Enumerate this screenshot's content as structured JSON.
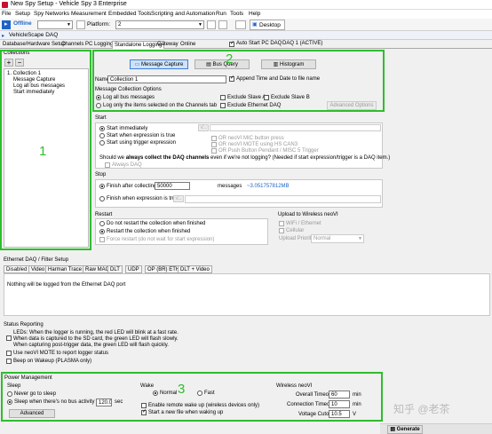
{
  "window": {
    "title": "New Spy Setup - Vehicle Spy 3 Enterprise"
  },
  "menu": [
    "File",
    "Setup",
    "Spy Networks",
    "Measurement",
    "Embedded Tools",
    "Scripting and Automation",
    "Run",
    "Tools",
    "Help"
  ],
  "toolbar": {
    "online_label": "Offline",
    "platform_label": "Platform:",
    "platform_value": "2",
    "desktop_tab": "Desktop 1"
  },
  "vehiclescape": {
    "title": "VehicleScape DAQ"
  },
  "tabs": [
    "Database/Hardware Setup",
    "Channels",
    "PC Logging",
    "Standalone Logging",
    "Gateway",
    "Online"
  ],
  "auto_start": {
    "label": "Auto Start PC DAQ",
    "daq_label": "DAQ 1 (ACTIVE)"
  },
  "collections": {
    "title": "Collections",
    "add": "+",
    "remove": "−",
    "root": "1. Collection 1",
    "children": [
      "Message Capture",
      "Log all bus messages",
      "Start immediately"
    ]
  },
  "capture_buttons": {
    "message_capture": "Message Capture",
    "bus_query": "Bus Query",
    "histogram": "Histogram"
  },
  "name_row": {
    "label": "Name",
    "value": "Collection 1",
    "append_label": "Append Time and Date to file name"
  },
  "msg_options": {
    "title": "Message Collection Options",
    "log_all": "Log all bus messages",
    "log_only": "Log only the items selected on the Channels tab",
    "exclude_a": "Exclude Slave A",
    "exclude_b": "Exclude Slave B",
    "exclude_eth": "Exclude Ethernet DAQ",
    "advanced": "Advanced Options"
  },
  "start": {
    "title": "Start",
    "immediately": "Start immediately",
    "when_expr": "Start when expression is true",
    "trigger_expr": "Start using trigger expression",
    "mic_button": "OR neoVI MIC button press",
    "mote_hs": "OR neoVI MOTE using HS CAN3",
    "push_button": "OR Push Button Pendant / MISC 5 Trigger",
    "should_prefix": "Should we ",
    "should_bold": "always collect the DAQ channels",
    "should_suffix": " even if we're not logging? (Needed if start expression/trigger is a DAQ item.)",
    "always_daq": "Always DAQ",
    "expr_btn": "√.."
  },
  "stop": {
    "title": "Stop",
    "finish_after": "Finish after collecting",
    "count": "50000",
    "messages": "messages",
    "size": "~3.051757812MB",
    "finish_when": "Finish when expression is true",
    "expr_btn": "√.."
  },
  "restart": {
    "title": "Restart",
    "do_not": "Do not restart the collection when finished",
    "restart": "Restart the collection when finished",
    "force": "Force restart (do not wait for start expression)"
  },
  "upload": {
    "title": "Upload to Wireless neoVI",
    "wifi": "WiFi / Ethernet",
    "cellular": "Cellular",
    "priority_label": "Upload Priority",
    "priority_value": "Normal"
  },
  "eth_daq": {
    "title": "Ethernet DAQ / Filter Setup",
    "tabs": [
      "Disabled",
      "Video",
      "Harman Trace",
      "Raw MAC",
      "DLT",
      "UDP",
      "OP (BR) ETH",
      "DLT + Video"
    ],
    "message": "Nothing will be logged from the Ethernet DAQ port"
  },
  "status": {
    "title": "Status Reporting",
    "leds_lines": [
      "LEDs: When the logger is running, the red LED will blink at a fast rate.",
      "When data is captured to the SD card, the green LED will flash slowly.",
      "When capturing post-trigger data, the green LED will flash quickly."
    ],
    "use_mote": "Use neoVI MOTE to report logger status",
    "beep": "Beep on Wakeup (PLASMA only)"
  },
  "power": {
    "title": "Power Management",
    "sleep_title": "Sleep",
    "never": "Never go to sleep",
    "sleep_when": "Sleep when there's no bus activity for",
    "sleep_value": "120.00",
    "sec": "sec",
    "advanced": "Advanced",
    "wake_title": "Wake",
    "normal": "Normal",
    "fast": "Fast",
    "remote_wakeup": "Enable remote wake up (wireless devices only)",
    "new_file": "Start a new file when waking up",
    "wireless_title": "Wireless neoVI",
    "overall_label": "Overall Timeout:",
    "overall_value": "60",
    "conn_label": "Connection Timeout:",
    "conn_value": "10",
    "voltage_label": "Voltage Cutoff:",
    "voltage_value": "10.5",
    "min": "min",
    "volt": "V"
  },
  "annotations": {
    "one": "1",
    "two": "2",
    "three": "3"
  },
  "watermark": "知乎 @老茶",
  "generate": "Generate",
  "colors": {
    "annotation_green": "#2ebd2e",
    "accent_blue": "#1e64c8",
    "offline_red": "#c8102e"
  }
}
